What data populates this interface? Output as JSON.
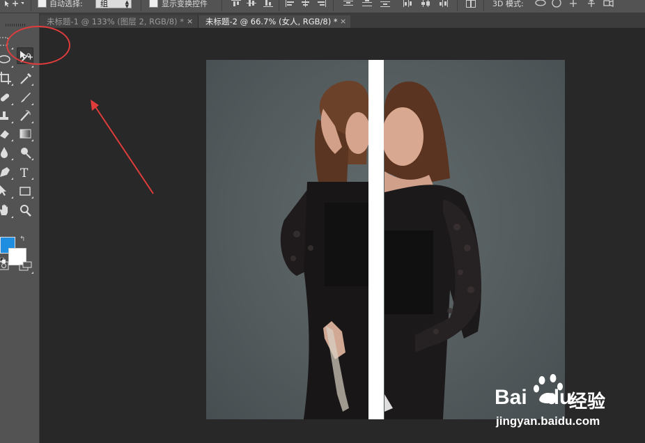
{
  "options_bar": {
    "auto_select_label": "自动选择:",
    "auto_select_value": "组",
    "show_transform_label": "显示变换控件",
    "mode_3d_label": "3D 模式:",
    "auto_select_checked": false,
    "show_transform_checked": false
  },
  "tabs": [
    {
      "label": "未标题-1 @ 133% (图层 2, RGB/8) *",
      "active": false
    },
    {
      "label": "未标题-2 @ 66.7% (女人, RGB/8) *",
      "active": true
    }
  ],
  "tab_close_glyph": "×",
  "toolbar": {
    "tools": [
      "marquee-icon",
      "move-icon",
      "lasso-icon",
      "quick-selection-icon",
      "crop-icon",
      "eyedropper-icon",
      "healing-brush-icon",
      "brush-icon",
      "clone-stamp-icon",
      "history-brush-icon",
      "eraser-icon",
      "gradient-icon",
      "blur-icon",
      "dodge-icon",
      "pen-icon",
      "type-icon",
      "path-selection-icon",
      "rectangle-icon",
      "hand-icon",
      "zoom-icon",
      "quick-mask-icon",
      "screen-mode-icon"
    ],
    "type_tool_glyph": "T",
    "foreground_color": "#1f8ee0",
    "background_color": "#ffffff"
  },
  "document": {
    "layer_name": "女人",
    "zoom": "66.7%"
  },
  "watermark": {
    "logo_text": "Bai",
    "logo_text_2": "du",
    "brand": "经验",
    "url": "jingyan.baidu.com"
  },
  "annotations": {
    "color": "#e13c3c"
  }
}
